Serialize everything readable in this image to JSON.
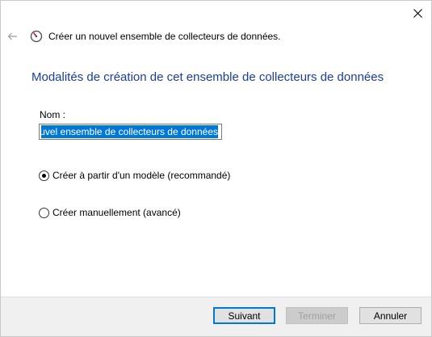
{
  "window": {
    "close_glyph": "✕"
  },
  "header": {
    "back_icon": "back-arrow-icon",
    "app_icon": "performance-monitor-icon",
    "title": "Créer un nouvel ensemble de collecteurs de données."
  },
  "main": {
    "heading": "Modalités de création de cet ensemble de collecteurs de données",
    "name_label": "Nom :",
    "name_value": "Nouvel ensemble de collecteurs de données",
    "name_visible": "ouvel ensemble de collecteurs de données",
    "options": [
      {
        "label": "Créer à partir d'un modèle (recommandé)",
        "selected": true
      },
      {
        "label": "Créer manuellement (avancé)",
        "selected": false
      }
    ]
  },
  "footer": {
    "next_label": "Suivant",
    "finish_label": "Terminer",
    "cancel_label": "Annuler"
  },
  "colors": {
    "heading": "#1a3e9c",
    "selection": "#0078d7",
    "footer_bg": "#f0f0f0"
  }
}
